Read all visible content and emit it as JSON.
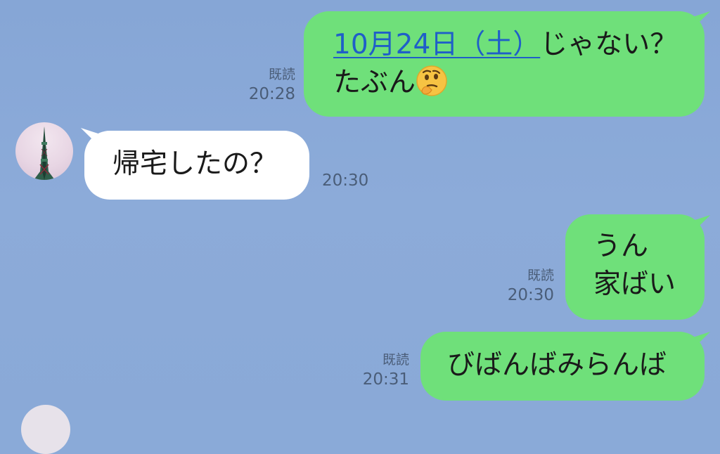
{
  "messages": [
    {
      "id": "m1",
      "direction": "sent",
      "link_text": "10月24日（土）",
      "text_after_link": "じゃない？",
      "line2": "たぶん",
      "emoji": "thinking-face-icon",
      "read": "既読",
      "time": "20:28"
    },
    {
      "id": "m2",
      "direction": "received",
      "text": "帰宅したの？",
      "time": "20:30"
    },
    {
      "id": "m3",
      "direction": "sent",
      "line1": "うん",
      "line2": "家ばい",
      "read": "既読",
      "time": "20:30"
    },
    {
      "id": "m4",
      "direction": "sent",
      "text": "びばんばみらんば",
      "read": "既読",
      "time": "20:31"
    }
  ],
  "colors": {
    "background": "#8aaad8",
    "sent_bubble": "#6fe07a",
    "received_bubble": "#ffffff",
    "link": "#1f5fc8",
    "meta_text": "#4a5d78"
  }
}
